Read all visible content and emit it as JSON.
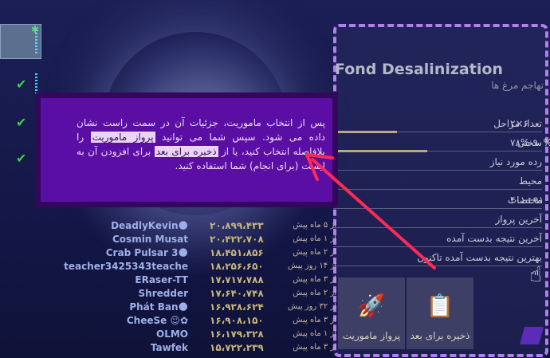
{
  "panel": {
    "title": "Fond Desalinization",
    "subtitle": "تهاجم مرغ ها",
    "rows": [
      {
        "label": "تعداد مراحل",
        "value": "۲×۶"
      },
      {
        "label": "سختی",
        "value": "۷۸%-۹۰%",
        "progress": 0.45
      },
      {
        "label": "رده مورد نیاز",
        "value": ""
      },
      {
        "label": "محیط",
        "value": ""
      },
      {
        "label": "مختصات",
        "value": "۴۰۱÷۹۱"
      },
      {
        "label": "آخرین پرواز",
        "value": ""
      },
      {
        "label": "آخرین نتیجه بدست آمده",
        "value": ""
      },
      {
        "label": "بهترین نتیجه بدست آمده تاکنون",
        "value": ""
      }
    ],
    "actions": [
      {
        "label": "پرواز ماموریت",
        "icon": "rocket-icon"
      },
      {
        "label": "ذخیره برای بعد",
        "icon": "clipboard-icon"
      }
    ]
  },
  "tooltip": {
    "text_before": "پس از انتخاب ماموریت، جزئیات آن در سمت راست نشان داده می شود. سپس شما می توانید ",
    "highlight1": "پرواز ماموریت",
    "text_middle": " را بلافاصله انتخاب کنید، یا از ",
    "highlight2": "ذخیره برای بعد",
    "text_after": " برای افزودن آن به لیست (برای انجام) شما استفاده کنید."
  },
  "leaderboard": [
    {
      "name": "DeadlyKevin🌑",
      "score": "۲۰،۸۹۹،۴۳۳",
      "time": "از ۵ ماه پیش"
    },
    {
      "name": "Cosmin Musat",
      "score": "۲۰،۴۲۲،۷۰۸",
      "time": "از ۱ ماه پیش"
    },
    {
      "name": "Crab Pulsar 3🌑",
      "score": "۱۸،۴۵۱،۸۵۶",
      "time": "از ۲ ماه پیش"
    },
    {
      "name": "teacher3425343teache",
      "score": "۱۸،۲۵۶،۶۵۰",
      "time": "از ۱۴ روز پیش"
    },
    {
      "name": "ERaser-TT",
      "score": "۱۷،۷۱۷،۷۸۸",
      "time": "از ۳ ماه پیش"
    },
    {
      "name": "Shredder",
      "score": "۱۷،۶۴۰،۷۴۸",
      "time": "از ۲ ماه پیش"
    },
    {
      "name": "Phát Ban🌑",
      "score": "۱۶،۹۳۸،۶۲۴",
      "time": "از ۳۲ روز پیش"
    },
    {
      "name": "CheeSe ☺✿",
      "score": "۱۶،۹۰۸،۱۵۰",
      "time": "از ۳ ماه پیش"
    },
    {
      "name": "OLMO",
      "score": "۱۶،۱۷۹،۳۲۸",
      "time": "از ۱ ماه پیش"
    },
    {
      "name": "Tawfek",
      "score": "۱۵،۷۲۲،۲۳۹",
      "time": "از ۳ ماه پیش"
    }
  ]
}
